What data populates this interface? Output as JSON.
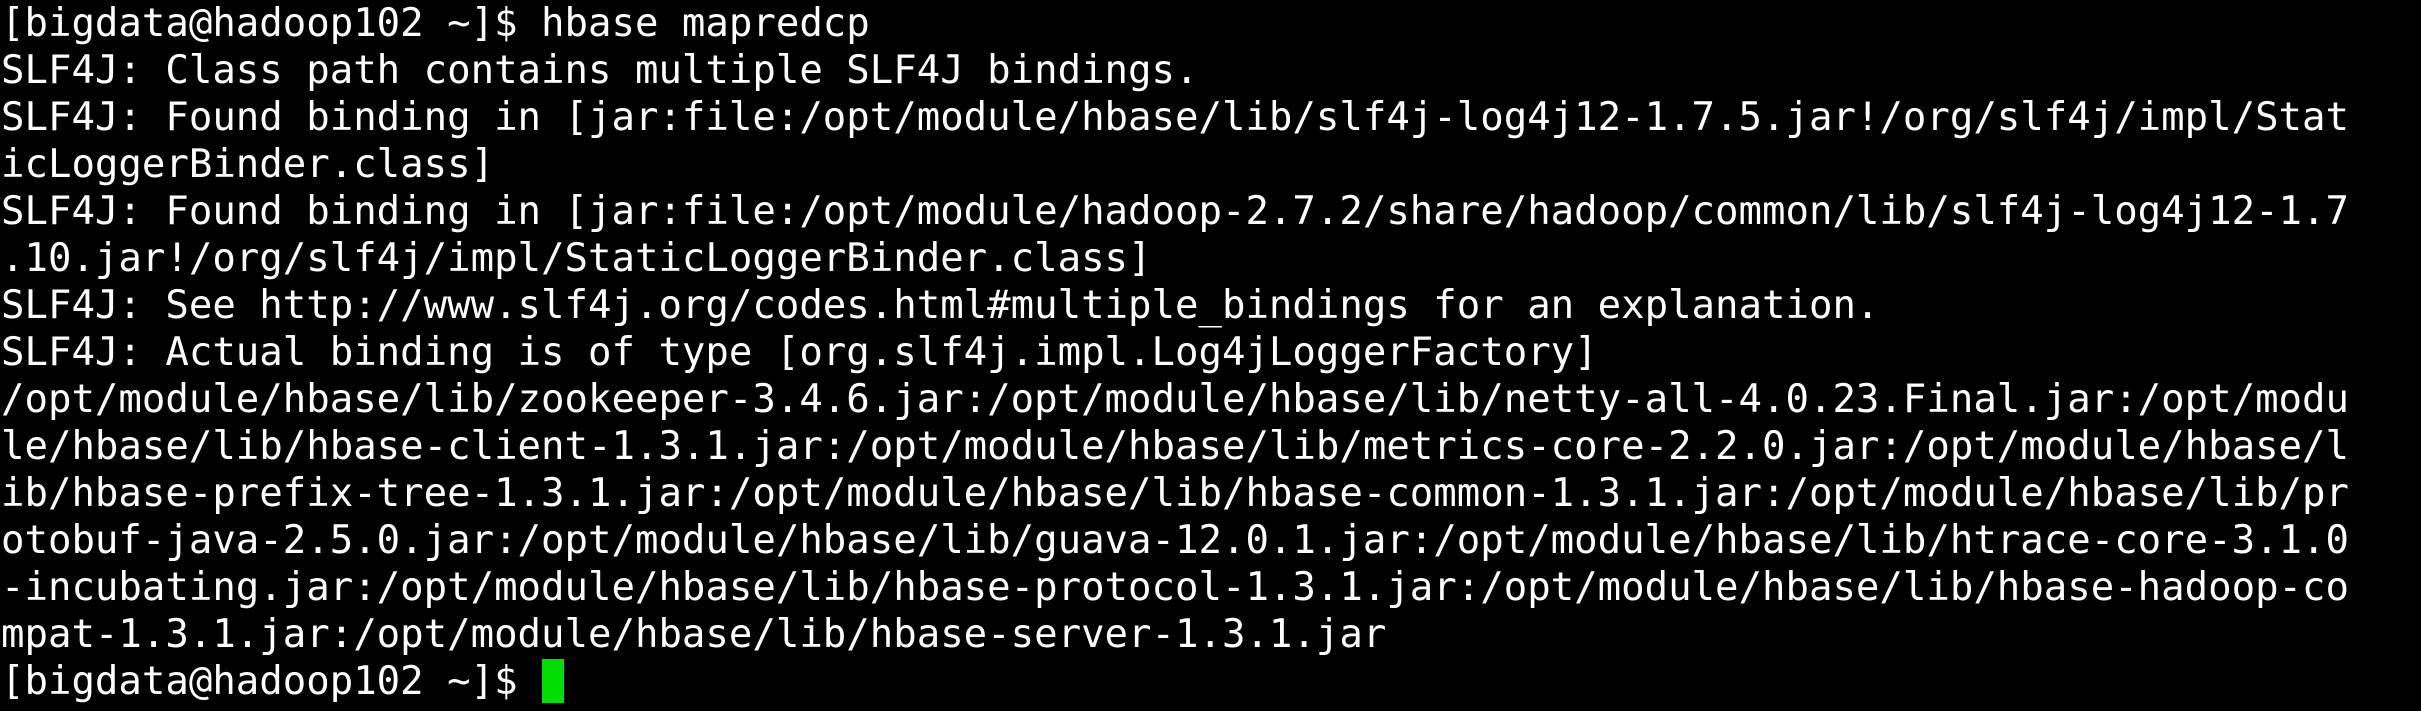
{
  "terminal": {
    "background": "#000000",
    "foreground": "#ffffff",
    "cursor_color": "#00dd00",
    "lines": [
      "[bigdata@hadoop102 ~]$ hbase mapredcp",
      "SLF4J: Class path contains multiple SLF4J bindings.",
      "SLF4J: Found binding in [jar:file:/opt/module/hbase/lib/slf4j-log4j12-1.7.5.jar!/org/slf4j/impl/Stat",
      "icLoggerBinder.class]",
      "SLF4J: Found binding in [jar:file:/opt/module/hadoop-2.7.2/share/hadoop/common/lib/slf4j-log4j12-1.7",
      ".10.jar!/org/slf4j/impl/StaticLoggerBinder.class]",
      "SLF4J: See http://www.slf4j.org/codes.html#multiple_bindings for an explanation.",
      "SLF4J: Actual binding is of type [org.slf4j.impl.Log4jLoggerFactory]",
      "/opt/module/hbase/lib/zookeeper-3.4.6.jar:/opt/module/hbase/lib/netty-all-4.0.23.Final.jar:/opt/modu",
      "le/hbase/lib/hbase-client-1.3.1.jar:/opt/module/hbase/lib/metrics-core-2.2.0.jar:/opt/module/hbase/l",
      "ib/hbase-prefix-tree-1.3.1.jar:/opt/module/hbase/lib/hbase-common-1.3.1.jar:/opt/module/hbase/lib/pr",
      "otobuf-java-2.5.0.jar:/opt/module/hbase/lib/guava-12.0.1.jar:/opt/module/hbase/lib/htrace-core-3.1.0",
      "-incubating.jar:/opt/module/hbase/lib/hbase-protocol-1.3.1.jar:/opt/module/hbase/lib/hbase-hadoop-co",
      "mpat-1.3.1.jar:/opt/module/hbase/lib/hbase-server-1.3.1.jar"
    ],
    "prompt": "[bigdata@hadoop102 ~]$ "
  }
}
